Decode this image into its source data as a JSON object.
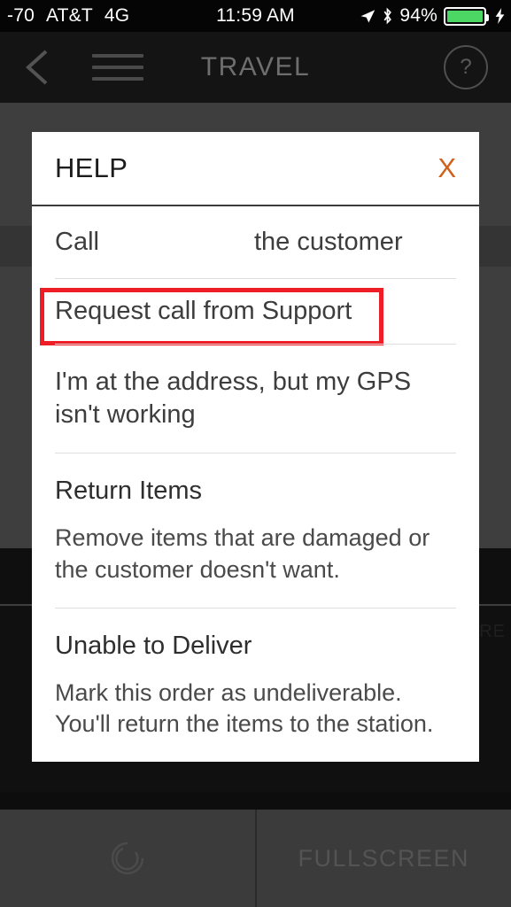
{
  "status_bar": {
    "signal": "-70",
    "carrier": "AT&T",
    "network": "4G",
    "time": "11:59 AM",
    "battery_percent": "94%",
    "battery_color": "#4cd764",
    "location_icon": "location-arrow-icon",
    "bluetooth_icon": "bluetooth-icon",
    "charging_icon": "lightning-bolt-icon"
  },
  "nav_bar": {
    "back_icon": "chevron-left-icon",
    "menu_icon": "hamburger-menu-icon",
    "title": "TRAVEL",
    "help_label": "?"
  },
  "background": {
    "partial_text": "HERE"
  },
  "modal": {
    "title": "HELP",
    "close_label": "X",
    "close_color": "#d1601a",
    "highlight_color": "#ee1d26",
    "options": [
      {
        "id": "call-the-customer",
        "kind": "split",
        "lead": "Call",
        "trail": "the customer",
        "highlighted": false
      },
      {
        "id": "request-call-from-support",
        "kind": "simple",
        "title": "Request call from Support",
        "highlighted": true
      },
      {
        "id": "gps-not-working",
        "kind": "simple",
        "title": "I'm at the address, but my GPS isn't working",
        "highlighted": false
      },
      {
        "id": "return-items",
        "kind": "titled",
        "title": "Return Items",
        "description": "Remove items that are damaged or the customer doesn't want.",
        "highlighted": false
      },
      {
        "id": "unable-to-deliver",
        "kind": "titled",
        "title": "Unable to Deliver",
        "description": "Mark this order as undeliverable. You'll return the items to the station.",
        "highlighted": false
      }
    ]
  },
  "bottom_bar": {
    "left_icon": "loading-spinner-icon",
    "right_label": "FULLSCREEN"
  }
}
